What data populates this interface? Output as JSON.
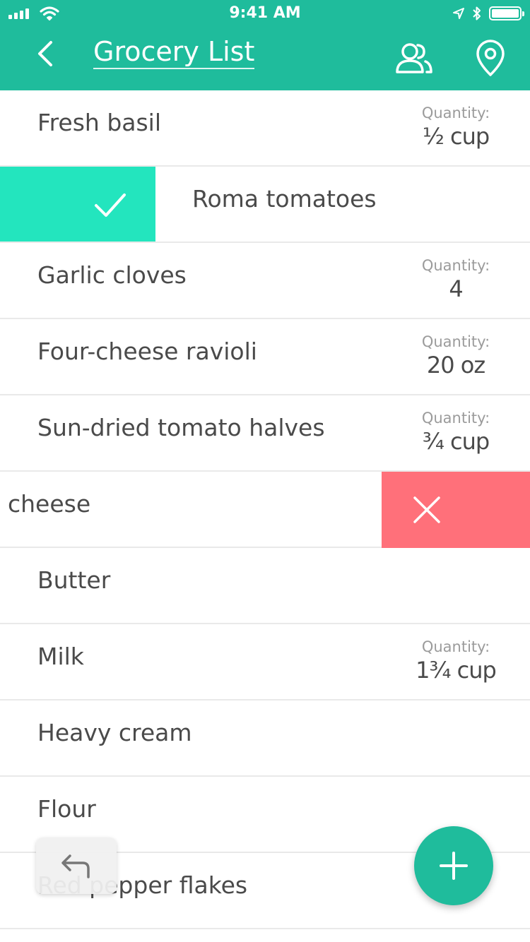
{
  "status_bar": {
    "time": "9:41 AM"
  },
  "header": {
    "title": "Grocery List"
  },
  "quantity_label": "Quantity:",
  "items": [
    {
      "name": "Fresh basil",
      "quantity": "½ cup"
    },
    {
      "name": "Roma tomatoes",
      "state": "swiped-complete"
    },
    {
      "name": "Garlic cloves",
      "quantity": "4"
    },
    {
      "name": "Four-cheese ravioli",
      "quantity": "20 oz"
    },
    {
      "name": "Sun-dried tomato halves",
      "quantity": "¾ cup"
    },
    {
      "name": "cheese",
      "state": "swiped-delete"
    },
    {
      "name": "Butter"
    },
    {
      "name": "Milk",
      "quantity": "1¾ cup"
    },
    {
      "name": "Heavy cream"
    },
    {
      "name": "Flour"
    },
    {
      "name": "Red pepper flakes"
    }
  ],
  "colors": {
    "accent": "#1fbc9c",
    "complete": "#23e5be",
    "delete": "#ff707a",
    "text": "#4a4a4a",
    "muted": "#9b9b9b"
  },
  "icons": {
    "back": "chevron-left-icon",
    "people": "people-icon",
    "location": "location-pin-icon",
    "complete": "checkmark-icon",
    "delete": "close-icon",
    "undo": "undo-icon",
    "add": "plus-icon"
  }
}
